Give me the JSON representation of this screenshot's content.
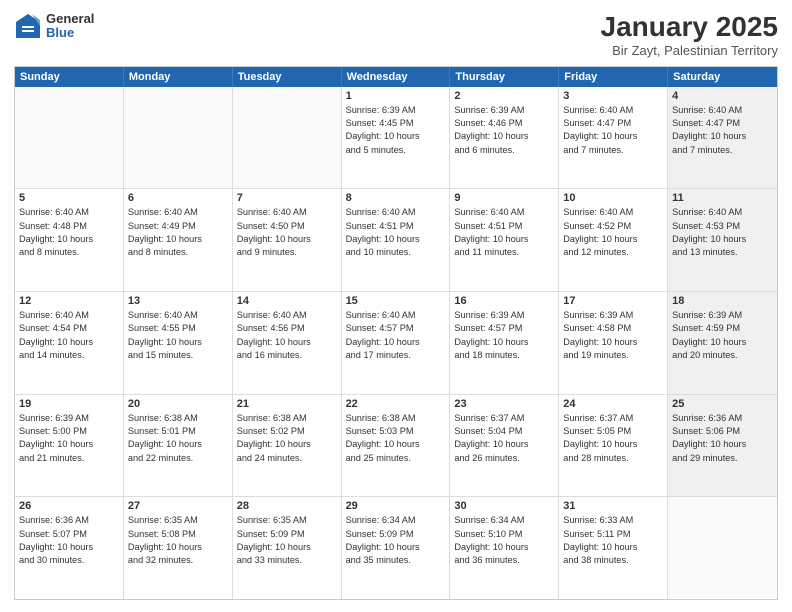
{
  "logo": {
    "general": "General",
    "blue": "Blue"
  },
  "title": "January 2025",
  "location": "Bir Zayt, Palestinian Territory",
  "days_of_week": [
    "Sunday",
    "Monday",
    "Tuesday",
    "Wednesday",
    "Thursday",
    "Friday",
    "Saturday"
  ],
  "weeks": [
    [
      {
        "day": "",
        "info": "",
        "shaded": false,
        "empty": true
      },
      {
        "day": "",
        "info": "",
        "shaded": false,
        "empty": true
      },
      {
        "day": "",
        "info": "",
        "shaded": false,
        "empty": true
      },
      {
        "day": "1",
        "info": "Sunrise: 6:39 AM\nSunset: 4:45 PM\nDaylight: 10 hours\nand 5 minutes.",
        "shaded": false,
        "empty": false
      },
      {
        "day": "2",
        "info": "Sunrise: 6:39 AM\nSunset: 4:46 PM\nDaylight: 10 hours\nand 6 minutes.",
        "shaded": false,
        "empty": false
      },
      {
        "day": "3",
        "info": "Sunrise: 6:40 AM\nSunset: 4:47 PM\nDaylight: 10 hours\nand 7 minutes.",
        "shaded": false,
        "empty": false
      },
      {
        "day": "4",
        "info": "Sunrise: 6:40 AM\nSunset: 4:47 PM\nDaylight: 10 hours\nand 7 minutes.",
        "shaded": true,
        "empty": false
      }
    ],
    [
      {
        "day": "5",
        "info": "Sunrise: 6:40 AM\nSunset: 4:48 PM\nDaylight: 10 hours\nand 8 minutes.",
        "shaded": false,
        "empty": false
      },
      {
        "day": "6",
        "info": "Sunrise: 6:40 AM\nSunset: 4:49 PM\nDaylight: 10 hours\nand 8 minutes.",
        "shaded": false,
        "empty": false
      },
      {
        "day": "7",
        "info": "Sunrise: 6:40 AM\nSunset: 4:50 PM\nDaylight: 10 hours\nand 9 minutes.",
        "shaded": false,
        "empty": false
      },
      {
        "day": "8",
        "info": "Sunrise: 6:40 AM\nSunset: 4:51 PM\nDaylight: 10 hours\nand 10 minutes.",
        "shaded": false,
        "empty": false
      },
      {
        "day": "9",
        "info": "Sunrise: 6:40 AM\nSunset: 4:51 PM\nDaylight: 10 hours\nand 11 minutes.",
        "shaded": false,
        "empty": false
      },
      {
        "day": "10",
        "info": "Sunrise: 6:40 AM\nSunset: 4:52 PM\nDaylight: 10 hours\nand 12 minutes.",
        "shaded": false,
        "empty": false
      },
      {
        "day": "11",
        "info": "Sunrise: 6:40 AM\nSunset: 4:53 PM\nDaylight: 10 hours\nand 13 minutes.",
        "shaded": true,
        "empty": false
      }
    ],
    [
      {
        "day": "12",
        "info": "Sunrise: 6:40 AM\nSunset: 4:54 PM\nDaylight: 10 hours\nand 14 minutes.",
        "shaded": false,
        "empty": false
      },
      {
        "day": "13",
        "info": "Sunrise: 6:40 AM\nSunset: 4:55 PM\nDaylight: 10 hours\nand 15 minutes.",
        "shaded": false,
        "empty": false
      },
      {
        "day": "14",
        "info": "Sunrise: 6:40 AM\nSunset: 4:56 PM\nDaylight: 10 hours\nand 16 minutes.",
        "shaded": false,
        "empty": false
      },
      {
        "day": "15",
        "info": "Sunrise: 6:40 AM\nSunset: 4:57 PM\nDaylight: 10 hours\nand 17 minutes.",
        "shaded": false,
        "empty": false
      },
      {
        "day": "16",
        "info": "Sunrise: 6:39 AM\nSunset: 4:57 PM\nDaylight: 10 hours\nand 18 minutes.",
        "shaded": false,
        "empty": false
      },
      {
        "day": "17",
        "info": "Sunrise: 6:39 AM\nSunset: 4:58 PM\nDaylight: 10 hours\nand 19 minutes.",
        "shaded": false,
        "empty": false
      },
      {
        "day": "18",
        "info": "Sunrise: 6:39 AM\nSunset: 4:59 PM\nDaylight: 10 hours\nand 20 minutes.",
        "shaded": true,
        "empty": false
      }
    ],
    [
      {
        "day": "19",
        "info": "Sunrise: 6:39 AM\nSunset: 5:00 PM\nDaylight: 10 hours\nand 21 minutes.",
        "shaded": false,
        "empty": false
      },
      {
        "day": "20",
        "info": "Sunrise: 6:38 AM\nSunset: 5:01 PM\nDaylight: 10 hours\nand 22 minutes.",
        "shaded": false,
        "empty": false
      },
      {
        "day": "21",
        "info": "Sunrise: 6:38 AM\nSunset: 5:02 PM\nDaylight: 10 hours\nand 24 minutes.",
        "shaded": false,
        "empty": false
      },
      {
        "day": "22",
        "info": "Sunrise: 6:38 AM\nSunset: 5:03 PM\nDaylight: 10 hours\nand 25 minutes.",
        "shaded": false,
        "empty": false
      },
      {
        "day": "23",
        "info": "Sunrise: 6:37 AM\nSunset: 5:04 PM\nDaylight: 10 hours\nand 26 minutes.",
        "shaded": false,
        "empty": false
      },
      {
        "day": "24",
        "info": "Sunrise: 6:37 AM\nSunset: 5:05 PM\nDaylight: 10 hours\nand 28 minutes.",
        "shaded": false,
        "empty": false
      },
      {
        "day": "25",
        "info": "Sunrise: 6:36 AM\nSunset: 5:06 PM\nDaylight: 10 hours\nand 29 minutes.",
        "shaded": true,
        "empty": false
      }
    ],
    [
      {
        "day": "26",
        "info": "Sunrise: 6:36 AM\nSunset: 5:07 PM\nDaylight: 10 hours\nand 30 minutes.",
        "shaded": false,
        "empty": false
      },
      {
        "day": "27",
        "info": "Sunrise: 6:35 AM\nSunset: 5:08 PM\nDaylight: 10 hours\nand 32 minutes.",
        "shaded": false,
        "empty": false
      },
      {
        "day": "28",
        "info": "Sunrise: 6:35 AM\nSunset: 5:09 PM\nDaylight: 10 hours\nand 33 minutes.",
        "shaded": false,
        "empty": false
      },
      {
        "day": "29",
        "info": "Sunrise: 6:34 AM\nSunset: 5:09 PM\nDaylight: 10 hours\nand 35 minutes.",
        "shaded": false,
        "empty": false
      },
      {
        "day": "30",
        "info": "Sunrise: 6:34 AM\nSunset: 5:10 PM\nDaylight: 10 hours\nand 36 minutes.",
        "shaded": false,
        "empty": false
      },
      {
        "day": "31",
        "info": "Sunrise: 6:33 AM\nSunset: 5:11 PM\nDaylight: 10 hours\nand 38 minutes.",
        "shaded": false,
        "empty": false
      },
      {
        "day": "",
        "info": "",
        "shaded": true,
        "empty": true
      }
    ]
  ]
}
